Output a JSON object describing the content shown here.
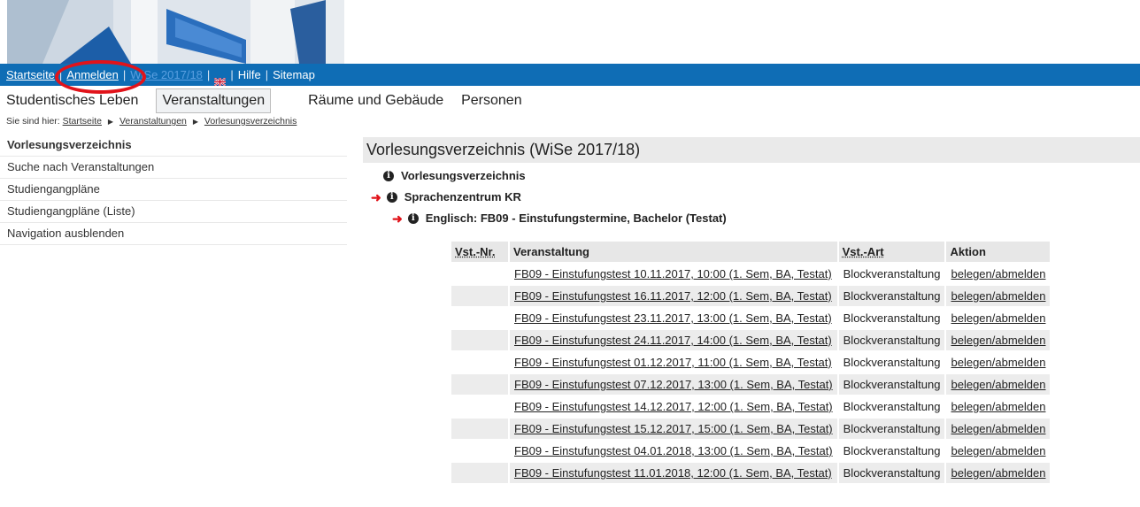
{
  "topbar": {
    "startseite": "Startseite",
    "anmelden": "Anmelden",
    "semester": "WiSe 2017/18",
    "hilfe": "Hilfe",
    "sitemap": "Sitemap",
    "separator": "|"
  },
  "mainmenu": {
    "tabs": [
      "Studentisches Leben",
      "Veranstaltungen",
      "Räume und Gebäude",
      "Personen"
    ],
    "active": "Veranstaltungen"
  },
  "breadcrumb": {
    "prefix": "Sie sind hier:",
    "items": [
      "Startseite",
      "Veranstaltungen",
      "Vorlesungsverzeichnis"
    ]
  },
  "sidebar": {
    "items": [
      "Vorlesungsverzeichnis",
      "Suche nach Veranstaltungen",
      "Studiengangpläne",
      "Studiengangpläne (Liste)",
      "Navigation ausblenden"
    ]
  },
  "content": {
    "title": "Vorlesungsverzeichnis (WiSe 2017/18)",
    "tree": [
      "Vorlesungsverzeichnis",
      "Sprachenzentrum KR",
      "Englisch: FB09 - Einstufungstermine, Bachelor (Testat)"
    ]
  },
  "table": {
    "headers": [
      "Vst.-Nr.",
      "Veranstaltung",
      "Vst.-Art",
      "Aktion"
    ],
    "rows": [
      {
        "nr": "",
        "name": "FB09 - Einstufungstest 10.11.2017, 10:00 (1. Sem, BA, Testat)",
        "art": "Blockveranstaltung",
        "aktion": "belegen/abmelden"
      },
      {
        "nr": "",
        "name": "FB09 - Einstufungstest 16.11.2017, 12:00 (1. Sem, BA, Testat)",
        "art": "Blockveranstaltung",
        "aktion": "belegen/abmelden"
      },
      {
        "nr": "",
        "name": "FB09 - Einstufungstest 23.11.2017, 13:00 (1. Sem, BA, Testat)",
        "art": "Blockveranstaltung",
        "aktion": "belegen/abmelden"
      },
      {
        "nr": "",
        "name": "FB09 - Einstufungstest 24.11.2017, 14:00 (1. Sem, BA, Testat)",
        "art": "Blockveranstaltung",
        "aktion": "belegen/abmelden"
      },
      {
        "nr": "",
        "name": "FB09 - Einstufungstest 01.12.2017, 11:00 (1. Sem, BA, Testat)",
        "art": "Blockveranstaltung",
        "aktion": "belegen/abmelden"
      },
      {
        "nr": "",
        "name": "FB09 - Einstufungstest 07.12.2017, 13:00 (1. Sem, BA, Testat)",
        "art": "Blockveranstaltung",
        "aktion": "belegen/abmelden"
      },
      {
        "nr": "",
        "name": "FB09 - Einstufungstest 14.12.2017, 12:00 (1. Sem, BA, Testat)",
        "art": "Blockveranstaltung",
        "aktion": "belegen/abmelden"
      },
      {
        "nr": "",
        "name": "FB09 - Einstufungstest 15.12.2017, 15:00 (1. Sem, BA, Testat)",
        "art": "Blockveranstaltung",
        "aktion": "belegen/abmelden"
      },
      {
        "nr": "",
        "name": "FB09 - Einstufungstest 04.01.2018, 13:00 (1. Sem, BA, Testat)",
        "art": "Blockveranstaltung",
        "aktion": "belegen/abmelden"
      },
      {
        "nr": "",
        "name": "FB09 - Einstufungstest 11.01.2018, 12:00 (1. Sem, BA, Testat)",
        "art": "Blockveranstaltung",
        "aktion": "belegen/abmelden"
      }
    ]
  },
  "colors": {
    "topbar": "#0f6db5",
    "highlight_circle": "#e1131a",
    "tree_arrow": "#e1131a",
    "header_bg": "#eaeaea"
  },
  "icons": [
    "university-logo-image",
    "uk-flag-icon",
    "info-icon",
    "red-arrow-icon"
  ]
}
